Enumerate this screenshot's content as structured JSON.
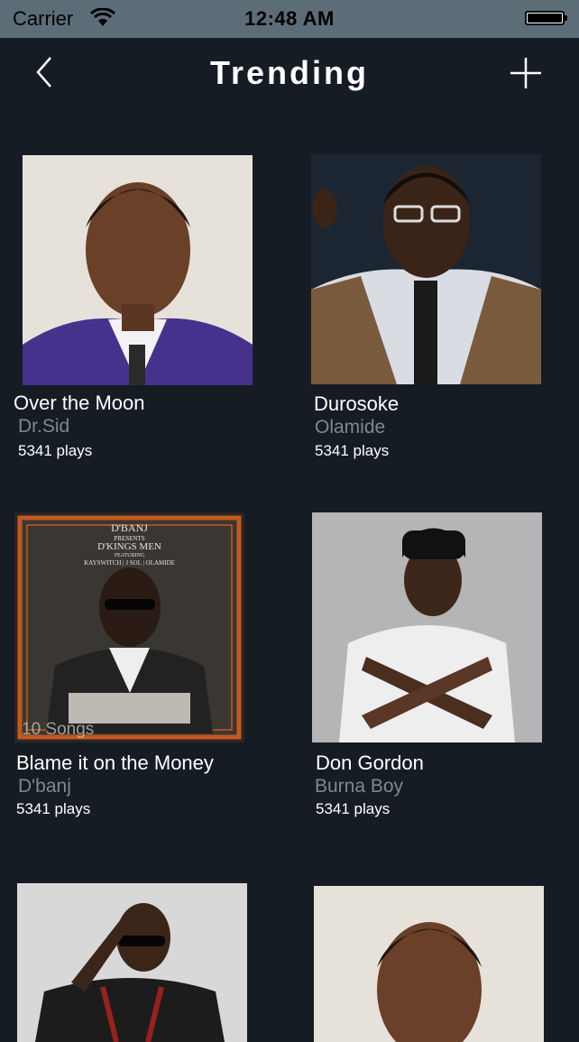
{
  "status_bar": {
    "carrier": "Carrier",
    "time": "12:48 AM",
    "wifi_icon": "wifi-icon",
    "battery_icon": "battery-icon"
  },
  "nav": {
    "title": "Trending",
    "back_icon": "chevron-left-icon",
    "add_icon": "plus-icon"
  },
  "tracks": [
    {
      "title": "Over the Moon",
      "artist": "Dr.Sid",
      "plays": "5341 plays"
    },
    {
      "title": "Durosoke",
      "artist": "Olamide",
      "plays": "5341 plays"
    },
    {
      "title": "Blame it on the Money",
      "artist": "D'banj",
      "plays": "5341 plays",
      "overlay": "10 Songs"
    },
    {
      "title": "Don Gordon",
      "artist": "Burna Boy",
      "plays": "5341 plays"
    },
    {
      "title": "",
      "artist": "",
      "plays": ""
    },
    {
      "title": "",
      "artist": "",
      "plays": ""
    }
  ],
  "album_art_text": {
    "title": "D'BANJ",
    "presents": "PRESENTS",
    "album": "D'KINGS MEN",
    "featuring": "FEATURING",
    "features": "KAYSWITCH | J SOL | OLAMIDE"
  },
  "colors": {
    "background": "#161c24",
    "status_bar": "#5d6d78",
    "artist_text": "#7e8893"
  }
}
